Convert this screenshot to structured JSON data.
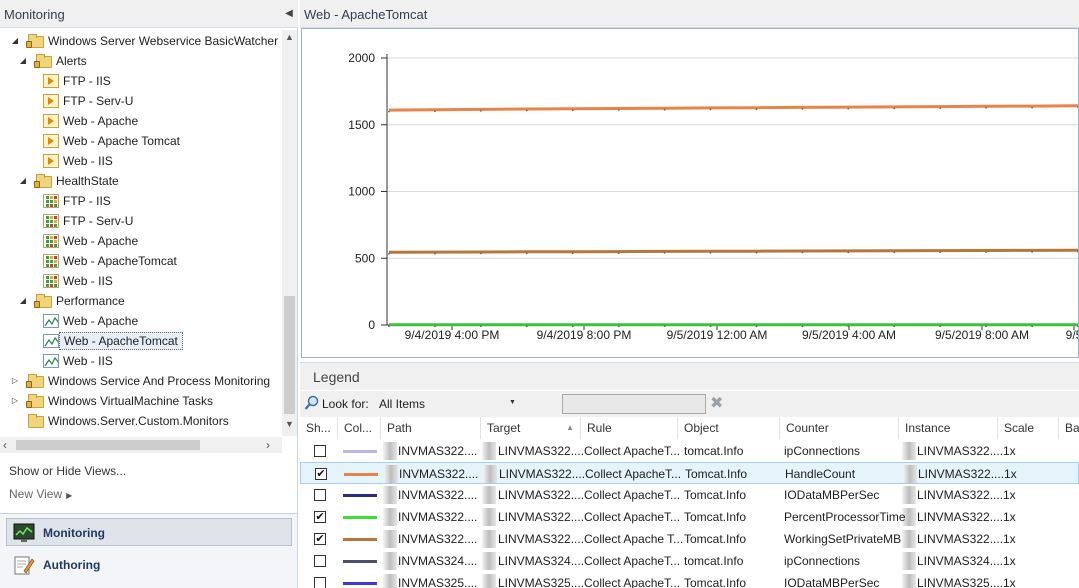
{
  "left": {
    "title": "Monitoring",
    "tree": [
      {
        "label": "Windows Server Webservice BasicWatcher",
        "icon": "locked-folder-icon",
        "level": 1,
        "exp": "open"
      },
      {
        "label": "Alerts",
        "icon": "locked-folder-icon",
        "level": 2,
        "exp": "open"
      },
      {
        "label": "FTP - IIS",
        "icon": "alert-view-icon",
        "level": 3
      },
      {
        "label": "FTP - Serv-U",
        "icon": "alert-view-icon",
        "level": 3
      },
      {
        "label": "Web - Apache",
        "icon": "alert-view-icon",
        "level": 3
      },
      {
        "label": "Web - Apache Tomcat",
        "icon": "alert-view-icon",
        "level": 3
      },
      {
        "label": "Web - IIS",
        "icon": "alert-view-icon",
        "level": 3
      },
      {
        "label": "HealthState",
        "icon": "locked-folder-icon",
        "level": 2,
        "exp": "open"
      },
      {
        "label": "FTP - IIS",
        "icon": "state-view-icon",
        "level": 3
      },
      {
        "label": "FTP - Serv-U",
        "icon": "state-view-icon",
        "level": 3
      },
      {
        "label": "Web - Apache",
        "icon": "state-view-icon",
        "level": 3
      },
      {
        "label": "Web - ApacheTomcat",
        "icon": "state-view-icon",
        "level": 3
      },
      {
        "label": "Web - IIS",
        "icon": "state-view-icon",
        "level": 3
      },
      {
        "label": "Performance",
        "icon": "locked-folder-icon",
        "level": 2,
        "exp": "open"
      },
      {
        "label": "Web - Apache",
        "icon": "performance-view-icon",
        "level": 3
      },
      {
        "label": "Web - ApacheTomcat",
        "icon": "performance-view-icon",
        "level": 3,
        "selected": true
      },
      {
        "label": "Web - IIS",
        "icon": "performance-view-icon",
        "level": 3
      },
      {
        "label": "Windows Service And Process Monitoring",
        "icon": "locked-folder-icon",
        "level": 1,
        "exp": "closed"
      },
      {
        "label": "Windows VirtualMachine Tasks",
        "icon": "locked-folder-icon",
        "level": 1,
        "exp": "closed"
      },
      {
        "label": "Windows.Server.Custom.Monitors",
        "icon": "folder-icon",
        "level": 1
      }
    ],
    "show_hide": "Show or Hide Views...",
    "new_view": "New View",
    "wunderbar": [
      {
        "label": "Monitoring",
        "active": true
      },
      {
        "label": "Authoring",
        "active": false
      }
    ]
  },
  "right": {
    "title": "Web - ApacheTomcat"
  },
  "chart_data": {
    "type": "line",
    "title": "",
    "ylim": [
      0,
      2000
    ],
    "yticks": [
      0,
      500,
      1000,
      1500,
      2000
    ],
    "xticks": [
      "9/4/2019 4:00 PM",
      "9/4/2019 8:00 PM",
      "9/5/2019 12:00 AM",
      "9/5/2019 4:00 AM",
      "9/5/2019 8:00 AM",
      "9/5"
    ],
    "grid": true,
    "series": [
      {
        "color": "#e8834a",
        "values": [
          1610,
          1612,
          1615,
          1618,
          1620,
          1622,
          1624,
          1626,
          1628,
          1630,
          1632,
          1634,
          1636,
          1638,
          1640,
          1642
        ]
      },
      {
        "color": "#b8763a",
        "values": [
          545,
          546,
          547,
          548,
          549,
          550,
          551,
          552,
          553,
          554,
          555,
          556,
          557,
          558,
          559,
          560
        ]
      },
      {
        "color": "#3ac43a",
        "values": [
          2,
          2,
          2,
          2,
          2,
          2,
          2,
          2,
          2,
          2,
          2,
          2,
          2,
          2,
          2,
          2
        ]
      }
    ]
  },
  "legend": {
    "title": "Legend",
    "look_for_label": "Look for:",
    "scope_value": "All Items",
    "columns": [
      "Sh...",
      "Col...",
      "Path",
      "Target",
      "Rule",
      "Object",
      "Counter",
      "Instance",
      "Scale",
      "Ba"
    ],
    "rows": [
      {
        "checked": false,
        "color": "#b9b6e8",
        "path": "INVMAS322....",
        "target": "LINVMAS322....",
        "rule": "Collect ApacheT...",
        "object": "tomcat.Info",
        "counter": "ipConnections",
        "instance": "LINVMAS322....",
        "scale": "1x",
        "highlight": false
      },
      {
        "checked": true,
        "color": "#e8834a",
        "path": "INVMAS322....",
        "target": "LINVMAS322....",
        "rule": "Collect ApacheT...",
        "object": "Tomcat.Info",
        "counter": "HandleCount",
        "instance": "LINVMAS322....",
        "scale": "1x",
        "highlight": true
      },
      {
        "checked": false,
        "color": "#2a2a8a",
        "path": "INVMAS322....",
        "target": "LINVMAS322....",
        "rule": "Collect ApacheT...",
        "object": "Tomcat.Info",
        "counter": "IODataMBPerSec",
        "instance": "LINVMAS322....",
        "scale": "1x",
        "highlight": false
      },
      {
        "checked": true,
        "color": "#3ae03a",
        "path": "INVMAS322....",
        "target": "LINVMAS322....",
        "rule": "Collect ApacheT...",
        "object": "Tomcat.Info",
        "counter": "PercentProcessorTime",
        "instance": "LINVMAS322....",
        "scale": "1x",
        "highlight": false
      },
      {
        "checked": true,
        "color": "#b8763a",
        "path": "INVMAS322....",
        "target": "LINVMAS322....",
        "rule": "Collect Apache T...",
        "object": "Tomcat.Info",
        "counter": "WorkingSetPrivateMB",
        "instance": "LINVMAS322....",
        "scale": "1x",
        "highlight": false
      },
      {
        "checked": false,
        "color": "#4a4f6e",
        "path": "INVMAS324....",
        "target": "LINVMAS324....",
        "rule": "Collect ApacheT...",
        "object": "tomcat.Info",
        "counter": "ipConnections",
        "instance": "LINVMAS324....",
        "scale": "1x",
        "highlight": false
      },
      {
        "checked": false,
        "color": "#3a3ad8",
        "path": "INVMAS325....",
        "target": "LINVMAS325....",
        "rule": "Collect ApacheT...",
        "object": "Tomcat.Info",
        "counter": "IODataMBPerSec",
        "instance": "LINVMAS325....",
        "scale": "1x",
        "highlight": false
      }
    ]
  }
}
